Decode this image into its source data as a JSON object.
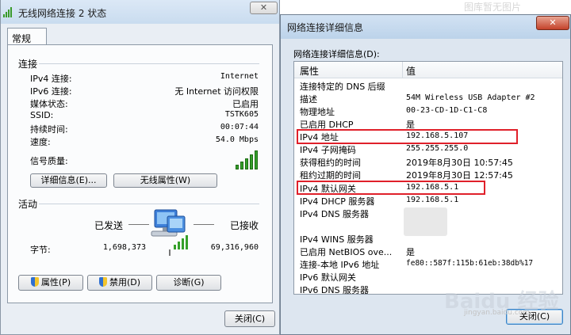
{
  "watermark_top": "图库暂无图片",
  "status_window": {
    "title": "无线网络连接 2 状态",
    "tab": "常规",
    "connection": {
      "section_title": "连接",
      "rows": [
        {
          "label": "IPv4 连接:",
          "value": "Internet"
        },
        {
          "label": "IPv6 连接:",
          "value": "无 Internet 访问权限"
        },
        {
          "label": "媒体状态:",
          "value": "已启用"
        },
        {
          "label": "SSID:",
          "value": "TSTK605"
        },
        {
          "label": "持续时间:",
          "value": "00:07:44"
        },
        {
          "label": "速度:",
          "value": "54.0 Mbps"
        }
      ],
      "signal_label": "信号质量:",
      "signal_bars_lit": 5,
      "details_button": "详细信息(E)...",
      "wireless_props_button": "无线属性(W)"
    },
    "activity": {
      "section_title": "活动",
      "sent_label": "已发送",
      "received_label": "已接收",
      "bytes_label": "字节:",
      "bytes_sent": "1,698,373",
      "bytes_received": "69,316,960"
    },
    "buttons": {
      "properties": "属性(P)",
      "disable": "禁用(D)",
      "diagnose": "诊断(G)",
      "close": "关闭(C)"
    }
  },
  "details_window": {
    "title": "网络连接详细信息",
    "label": "网络连接详细信息(D):",
    "columns": [
      "属性",
      "值"
    ],
    "rows": [
      {
        "prop": "连接特定的 DNS 后缀",
        "val": ""
      },
      {
        "prop": "描述",
        "val": "54M Wireless USB Adapter #2"
      },
      {
        "prop": "物理地址",
        "val": "00-23-CD-1D-C1-C8"
      },
      {
        "prop": "已启用 DHCP",
        "val": "是"
      },
      {
        "prop": "IPv4 地址",
        "val": "192.168.5.107"
      },
      {
        "prop": "IPv4 子网掩码",
        "val": "255.255.255.0"
      },
      {
        "prop": "获得租约的时间",
        "val": "2019年8月30日 10:57:45"
      },
      {
        "prop": "租约过期的时间",
        "val": "2019年8月30日 12:57:45"
      },
      {
        "prop": "IPv4 默认网关",
        "val": "192.168.5.1"
      },
      {
        "prop": "IPv4 DHCP 服务器",
        "val": "192.168.5.1"
      },
      {
        "prop": "IPv4 DNS 服务器",
        "val": ""
      },
      {
        "prop": "",
        "val": ""
      },
      {
        "prop": "IPv4 WINS 服务器",
        "val": ""
      },
      {
        "prop": "已启用 NetBIOS ove...",
        "val": "是"
      },
      {
        "prop": "连接-本地 IPv6 地址",
        "val": "fe80::587f:115b:61eb:38db%17"
      },
      {
        "prop": "IPv6 默认网关",
        "val": ""
      },
      {
        "prop": "IPv6 DNS 服务器",
        "val": ""
      }
    ],
    "close_button": "关闭(C)"
  },
  "watermark": "Baidu 经验",
  "watermark_sub": "jingyan.baidu.com",
  "colors": {
    "highlight_box": "#e0202a",
    "signal_green": "#35a02a"
  }
}
